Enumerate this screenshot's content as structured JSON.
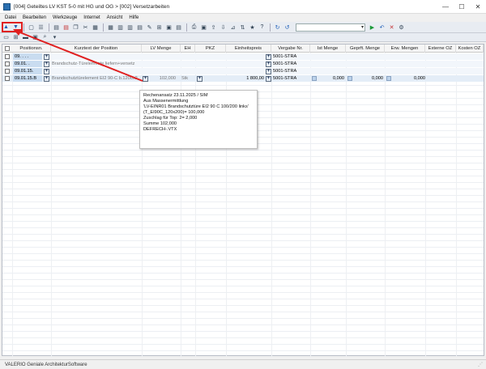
{
  "window": {
    "title": "[004] Geteiltes LV KST 5-0 mit HG und OG > [002] Versetzarbeiten",
    "minimize": "—",
    "maximize": "☐",
    "close": "✕"
  },
  "menu": [
    "Datei",
    "Bearbeiten",
    "Werkzeuge",
    "Internet",
    "Ansicht",
    "Hilfe"
  ],
  "columns": {
    "position": "Positionsn.",
    "short_text": "Kurztext der Position",
    "lv_menge": "LV Menge",
    "eh": "EH",
    "pkz": "PKZ",
    "einheitspreis": "Einheitspreis",
    "vergabe_nr": "Vergabe Nr.",
    "ist_menge": "Ist Menge",
    "gepr_menge": "Geprft. Menge",
    "erw_mengen": "Erw. Mengen",
    "externe_oz": "Externe OZ",
    "kosten_oz": "Kosten OZ"
  },
  "rows": [
    {
      "position": "09. . . .",
      "short_text": "",
      "lv_menge": "",
      "eh": "",
      "einheitspreis": "",
      "vergabe": "5001-STRA",
      "ist": "",
      "gepr": "",
      "erw": ""
    },
    {
      "position": "09.01. .",
      "short_text": "Brandschutz-Türelemente liefern+versetz",
      "lv_menge": "",
      "eh": "",
      "einheitspreis": "",
      "vergabe": "5001-STRA",
      "ist": "",
      "gepr": "",
      "erw": ""
    },
    {
      "position": "09.01.15.",
      "short_text": "",
      "lv_menge": "",
      "eh": "",
      "einheitspreis": "",
      "vergabe": "5001-STRA",
      "ist": "",
      "gepr": "",
      "erw": ""
    },
    {
      "position": "09.01.15.B",
      "short_text": "Brandschutztürelement EI2 90-C b.1200x2",
      "lv_menge": "102,000",
      "eh": "Stk",
      "einheitspreis": "1 800,00",
      "vergabe": "5001-STRA",
      "ist": "0,000",
      "gepr": "0,000",
      "erw": "0,000"
    }
  ],
  "tooltip": {
    "lines": [
      "Rechenansatz 23.11.2025 / SIM",
      "Aus Massenermittlung",
      "'LV-EINR01 Brandschutztüre EI2 90 C 100/200 links'",
      "(T_EI90C_120x200)= 100,000",
      "Zuschlag für Top: 2= 2,000",
      "Summe 102,000",
      "DEFRECH-.VTX"
    ]
  },
  "status": {
    "text": "VALERIO Geniale ArchitekturSoftware"
  },
  "colors": {
    "highlight": "#e02020",
    "selected_row": "#e4edf7",
    "position_cell": "#c9dcf0"
  }
}
